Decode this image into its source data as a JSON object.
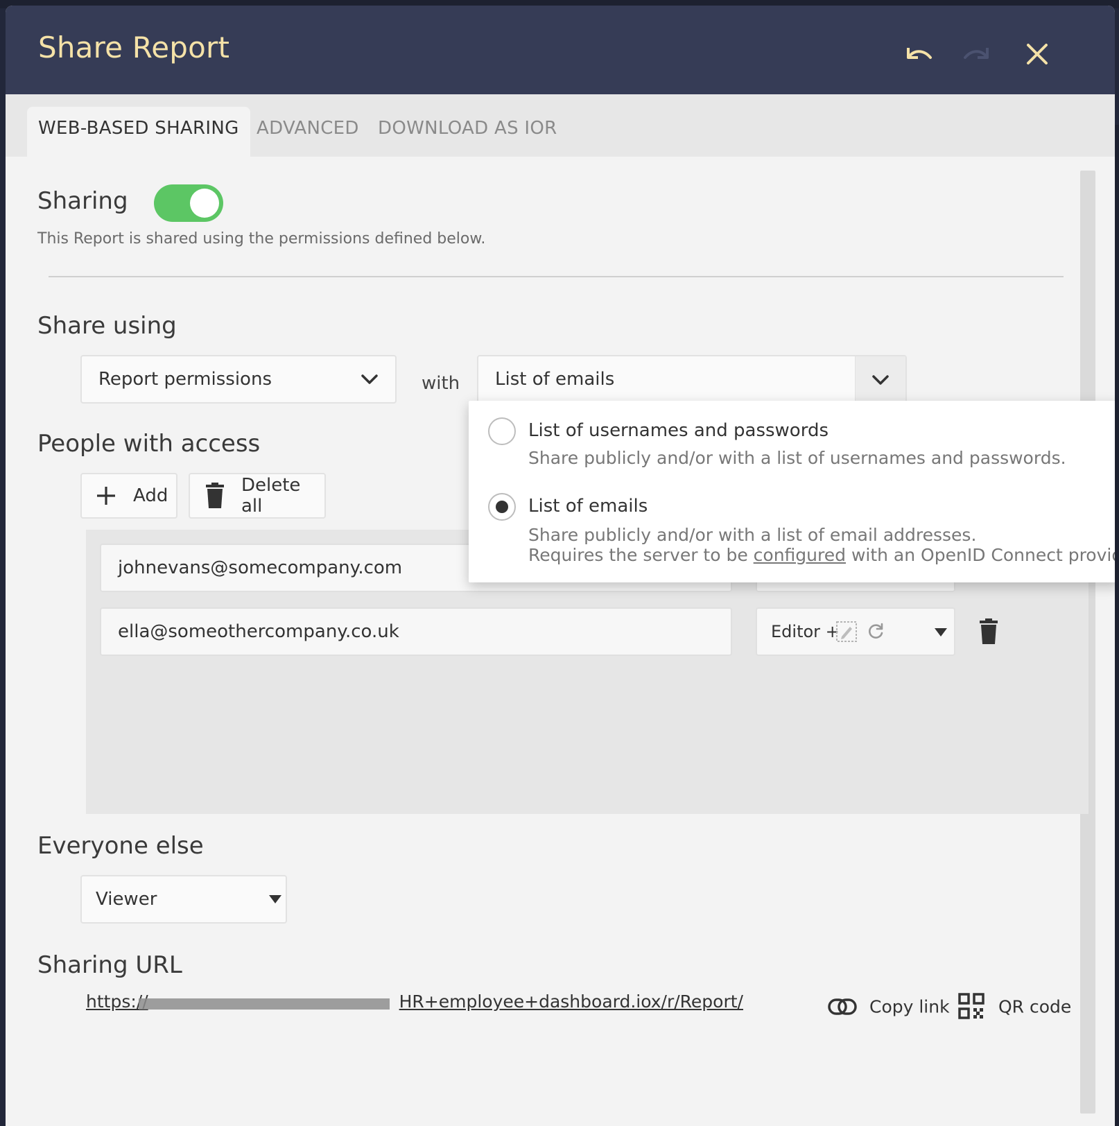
{
  "dialog": {
    "title": "Share Report"
  },
  "tabs": [
    {
      "label": "WEB-BASED SHARING",
      "active": true
    },
    {
      "label": "ADVANCED",
      "active": false
    },
    {
      "label": "DOWNLOAD AS IOR",
      "active": false
    }
  ],
  "sharing": {
    "heading": "Sharing",
    "enabled": true,
    "description": "This Report is shared using the permissions defined below."
  },
  "share_using": {
    "heading": "Share using",
    "permission_select": "Report permissions",
    "with_label": "with",
    "method_select": "List of emails"
  },
  "method_options": [
    {
      "title": "List of usernames and passwords",
      "description": "Share publicly and/or with a list of usernames and passwords.",
      "selected": false
    },
    {
      "title": "List of emails",
      "description_line1": "Share publicly and/or with a list of email addresses.",
      "description_line2_prefix": "Requires the server to be ",
      "description_line2_link": "configured",
      "description_line2_suffix": " with an OpenID Connect provid",
      "selected": true
    }
  ],
  "people": {
    "heading": "People with access",
    "add_label": "Add",
    "delete_all_label": "Delete all",
    "rows": [
      {
        "email": "johnevans@somecompany.com",
        "role": ""
      },
      {
        "email": "ella@someothercompany.co.uk",
        "role": "Editor +"
      }
    ]
  },
  "everyone_else": {
    "heading": "Everyone else",
    "role": "Viewer"
  },
  "sharing_url": {
    "heading": "Sharing URL",
    "url_prefix": "https://",
    "url_suffix": "HR+employee+dashboard.iox/r/Report/",
    "copy_label": "Copy link",
    "qr_label": "QR code"
  },
  "colors": {
    "header_bg": "#363c56",
    "title_color": "#f5e2a8",
    "toggle_on": "#5cc664"
  }
}
